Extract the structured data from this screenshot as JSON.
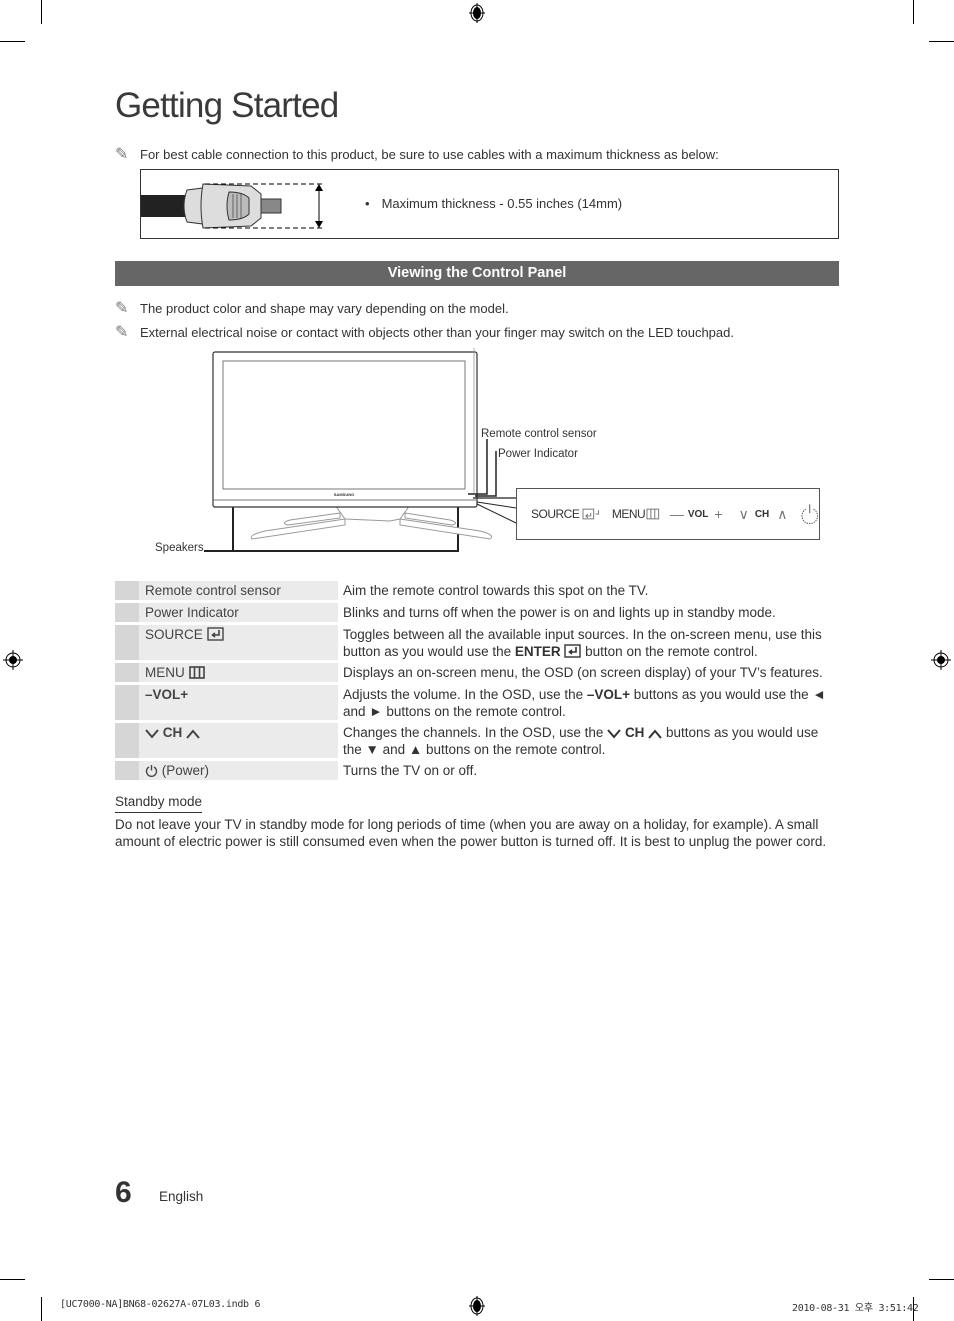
{
  "page": {
    "title": "Getting Started",
    "page_number": "6",
    "language": "English"
  },
  "cable_note": {
    "text": "For best cable connection to this product, be sure to use cables with a maximum thickness as below:",
    "spec_bullet": "•",
    "spec": "Maximum thickness - 0.55 inches (14mm)"
  },
  "section": {
    "title": "Viewing the Control Panel",
    "notes": [
      "The product color and shape may vary depending on the model.",
      "External electrical noise or contact with objects other than your finger may switch on the LED touchpad."
    ]
  },
  "diagram": {
    "brand": "SAMSUNG",
    "callouts": {
      "remote_sensor": "Remote control sensor",
      "power_indicator": "Power Indicator",
      "speakers": "Speakers"
    },
    "panel": {
      "source": "SOURCE",
      "menu": "MENU",
      "vol_minus": "—",
      "vol": "VOL",
      "vol_plus": "+",
      "ch_down": "∨",
      "ch": "CH",
      "ch_up": "∧"
    }
  },
  "controls": [
    {
      "name": "Remote control sensor",
      "desc": "Aim the remote control towards this spot on the TV."
    },
    {
      "name": "Power Indicator",
      "desc": "Blinks and turns off when the power is on and lights up in standby mode."
    },
    {
      "name": "SOURCE",
      "desc_pre": "Toggles between all the available input sources. In the on-screen menu, use this button as you would use the ",
      "desc_bold": "ENTER",
      "desc_post": " button on the remote control."
    },
    {
      "name": "MENU",
      "desc": "Displays an on-screen menu, the OSD (on screen display) of your TV’s features."
    },
    {
      "name": "–VOL+",
      "desc_pre": "Adjusts the volume. In the OSD, use the ",
      "desc_bold": "–VOL+",
      "desc_post": " buttons as you would use the ◄ and ► buttons on the remote control."
    },
    {
      "name": "CH",
      "desc_pre": "Changes the channels. In the OSD, use the ",
      "desc_bold": "CH",
      "desc_post": " buttons as you would use the ▼ and ▲ buttons on the remote control."
    },
    {
      "name": "(Power)",
      "desc": "Turns the TV on or off."
    }
  ],
  "standby": {
    "title": "Standby mode",
    "text": "Do not leave your TV in standby mode for long periods of time (when you are away on a holiday, for example). A small amount of electric power is still consumed even when the power button is turned off. It is best to unplug the power cord."
  },
  "print_slug": {
    "file": "[UC7000-NA]BN68-02627A-07L03.indb   6",
    "timestamp": "2010-08-31   오후 3:51:42"
  }
}
